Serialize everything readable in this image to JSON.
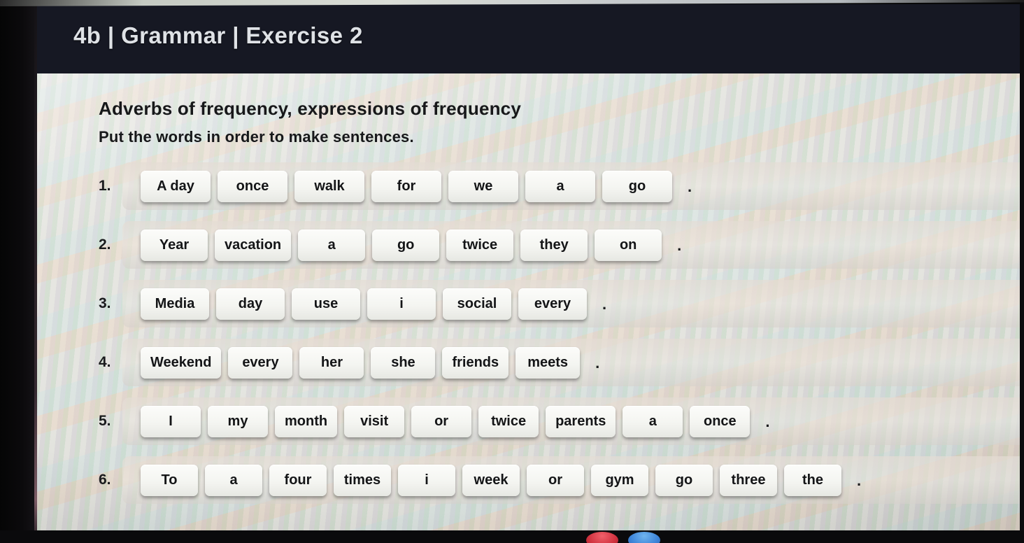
{
  "slide": {
    "header": {
      "title": "4b | Grammar | Exercise 2"
    },
    "heading": "Adverbs of frequency, expressions of frequency",
    "subheading": "Put the words in order to make sentences.",
    "sentence_terminator": ".",
    "questions": [
      {
        "number": "1.",
        "words": [
          "A day",
          "once",
          "walk",
          "for",
          "we",
          "a",
          "go"
        ]
      },
      {
        "number": "2.",
        "words": [
          "Year",
          "vacation",
          "a",
          "go",
          "twice",
          "they",
          "on"
        ]
      },
      {
        "number": "3.",
        "words": [
          "Media",
          "day",
          "use",
          "i",
          "social",
          "every"
        ]
      },
      {
        "number": "4.",
        "words": [
          "Weekend",
          "every",
          "her",
          "she",
          "friends",
          "meets"
        ]
      },
      {
        "number": "5.",
        "words": [
          "I",
          "my",
          "month",
          "visit",
          "or",
          "twice",
          "parents",
          "a",
          "once"
        ]
      },
      {
        "number": "6.",
        "words": [
          "To",
          "a",
          "four",
          "times",
          "i",
          "week",
          "or",
          "gym",
          "go",
          "three",
          "the"
        ]
      }
    ]
  },
  "device_controls": {
    "record_button_color": "#d0323f",
    "primary_button_color": "#3d84d8"
  },
  "colors": {
    "header_background": "#161823",
    "header_text": "#dfe2e6",
    "slide_background": "#d9dad6",
    "body_text": "#17181a",
    "tile_background": "#fcfcfa"
  }
}
